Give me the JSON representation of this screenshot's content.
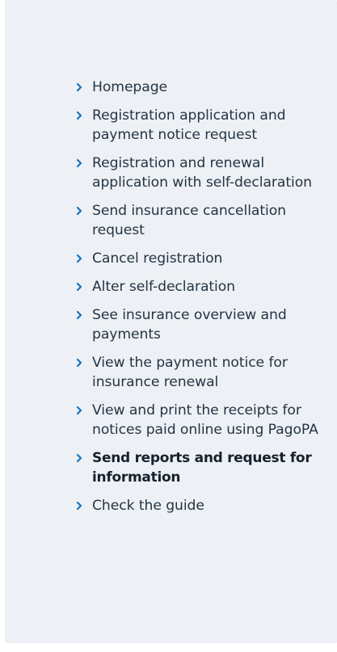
{
  "sidebar": {
    "icon": "chevron-right-icon",
    "accent_color": "#1a73b8",
    "background_color": "#edf1f5",
    "items": [
      {
        "label": "Homepage"
      },
      {
        "label": "Registration application and payment notice request"
      },
      {
        "label": "Registration and renewal application with self-declaration"
      },
      {
        "label": "Send insurance cancellation request"
      },
      {
        "label": "Cancel registration"
      },
      {
        "label": "Alter self-declaration"
      },
      {
        "label": "See insurance overview and payments"
      },
      {
        "label": "View the payment notice for insurance renewal"
      },
      {
        "label": "View and print the receipts for notices paid online using PagoPA"
      },
      {
        "label": "Send reports and request for information"
      },
      {
        "label": "Check the guide"
      }
    ]
  }
}
